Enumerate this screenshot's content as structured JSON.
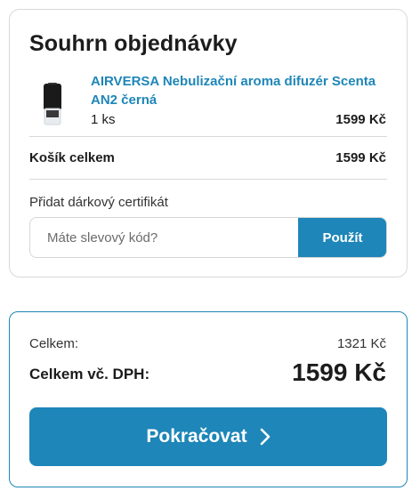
{
  "summary": {
    "title": "Souhrn objednávky",
    "item": {
      "name": "AIRVERSA Nebulizační aroma difuzér Scenta AN2 černá",
      "quantity": "1 ks",
      "price": "1599 Kč",
      "image_icon": "product-thumbnail"
    },
    "cart_total_label": "Košík celkem",
    "cart_total_value": "1599 Kč",
    "gift_label": "Přidat dárkový certifikát",
    "coupon_placeholder": "Máte slevový kód?",
    "coupon_value": "",
    "apply_label": "Použít"
  },
  "totals": {
    "subtotal_label": "Celkem:",
    "subtotal_value": "1321 Kč",
    "vat_label": "Celkem vč. DPH:",
    "vat_value": "1599 Kč",
    "continue_label": "Pokračovat",
    "continue_icon": "chevron-right-icon"
  },
  "colors": {
    "accent": "#1e86b8",
    "border": "#d9d9d9",
    "text": "#1c1c1c"
  }
}
